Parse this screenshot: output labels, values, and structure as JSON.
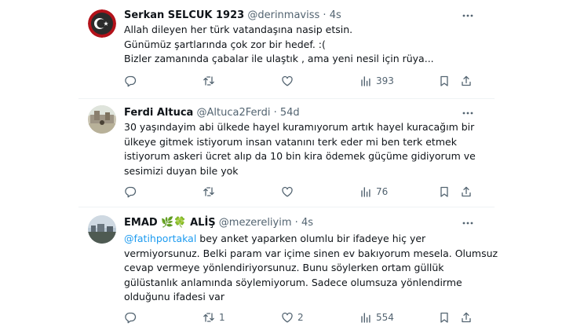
{
  "tweets": [
    {
      "display_name": "Serkan SELCUK 1923",
      "handle": "@derinmaviss",
      "separator": "·",
      "time": "4s",
      "lines": [
        "Allah dileyen her türk vatandaşına nasip etsin.",
        "Günümüz şartlarında çok zor bir hedef. :(",
        "Bizler zamanında çabalar ile ulaştık , ama yeni nesil için rüya..."
      ],
      "replies": "",
      "retweets": "",
      "likes": "",
      "views": "393"
    },
    {
      "display_name": "Ferdi Altuca",
      "handle": "@Altuca2Ferdi",
      "separator": "·",
      "time": "54d",
      "lines": [
        "30 yaşındayim abi ülkede hayel kuramıyorum artık hayel kuracağım bir",
        "ülkeye gitmek istiyorum insan vatanını terk eder mi ben terk etmek",
        "istiyorum askeri ücret alıp da 10 bin kira ödemek güçüme gidiyorum ve",
        "sesimizi duyan bile yok"
      ],
      "replies": "",
      "retweets": "",
      "likes": "",
      "views": "76"
    },
    {
      "display_name": "EMAD 🌿🍀 ALİŞ",
      "handle": "@mezereliyim",
      "separator": "·",
      "time": "4s",
      "mention": "@fatihportakal",
      "first_line_rest": " bey anket yaparken olumlu bir ifadeye hiç yer",
      "lines": [
        "vermiyorsunuz. Belki param var içime sinen ev bakıyorum mesela. Olumsuz",
        "cevap vermeye yönlendiriyorsunuz. Bunu söylerken ortam güllük",
        "gülüstanlık anlamında söylemiyorum. Sadece olumsuza yönlendirme",
        "olduğunu ifadesi var"
      ],
      "replies": "",
      "retweets": "1",
      "likes": "2",
      "views": "554"
    }
  ],
  "colors": {
    "text": "#0f1419",
    "secondary": "#536471",
    "link": "#1d9bf0",
    "divider": "#eff3f4"
  },
  "icons": [
    "more-icon",
    "reply-icon",
    "retweet-icon",
    "like-icon",
    "views-icon",
    "bookmark-icon",
    "share-icon"
  ]
}
